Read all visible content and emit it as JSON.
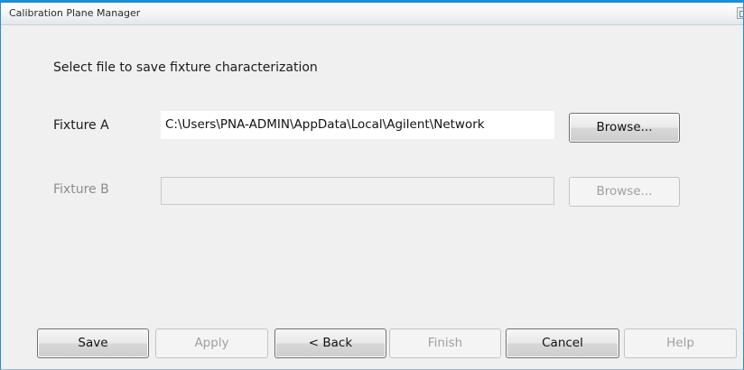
{
  "window": {
    "title": "Calibration Plane Manager"
  },
  "instruction": "Select file to save fixture characterization",
  "fixture_a": {
    "label": "Fixture A",
    "path": "C:\\Users\\PNA-ADMIN\\AppData\\Local\\Agilent\\Network",
    "browse_label": "Browse..."
  },
  "fixture_b": {
    "label": "Fixture B",
    "path": "",
    "browse_label": "Browse..."
  },
  "buttons": {
    "save": "Save",
    "apply": "Apply",
    "back": "< Back",
    "finish": "Finish",
    "cancel": "Cancel",
    "help": "Help"
  },
  "icons": {
    "title_control": "restore-icon"
  },
  "colors": {
    "window_border": "#1e8fd6",
    "background": "#f0f0f0"
  }
}
